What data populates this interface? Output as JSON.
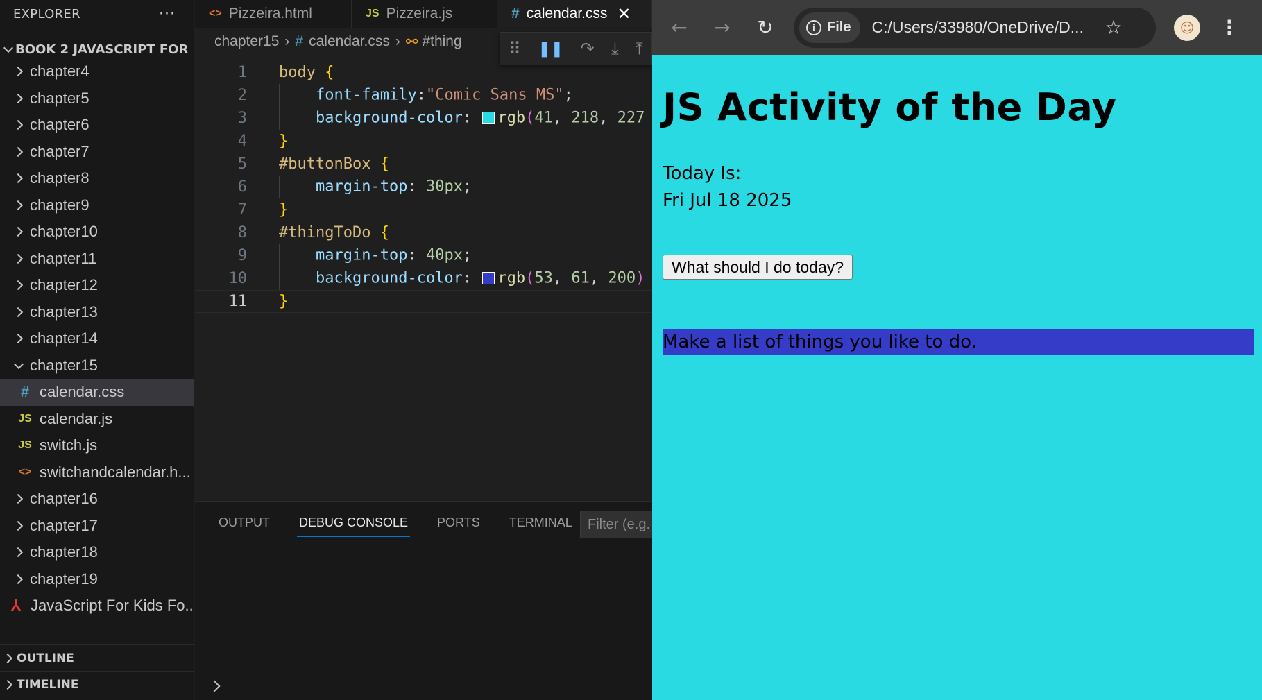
{
  "vscode": {
    "explorer": {
      "title": "EXPLORER",
      "more": "···",
      "project": "BOOK 2 JAVASCRIPT FOR ...",
      "folders_top": [
        "chapter4",
        "chapter5",
        "chapter6",
        "chapter7",
        "chapter8",
        "chapter9",
        "chapter10",
        "chapter11",
        "chapter12",
        "chapter13",
        "chapter14"
      ],
      "open_folder": "chapter15",
      "files": [
        {
          "icon": "#",
          "name": "calendar.css"
        },
        {
          "icon": "JS",
          "name": "calendar.js"
        },
        {
          "icon": "JS",
          "name": "switch.js"
        },
        {
          "icon": "<>",
          "name": "switchandcalendar.h..."
        }
      ],
      "folders_bottom": [
        "chapter16",
        "chapter17",
        "chapter18",
        "chapter19"
      ],
      "pdf_file": "JavaScript For Kids Fo...",
      "outline": "OUTLINE",
      "timeline": "TIMELINE"
    },
    "tabs": [
      {
        "icon": "<>",
        "label": "Pizzeira.html"
      },
      {
        "icon": "JS",
        "label": "Pizzeira.js"
      },
      {
        "icon": "#",
        "label": "calendar.css",
        "close": "✕"
      }
    ],
    "breadcrumbs": {
      "folder": "chapter15",
      "file_icon": "#",
      "file": "calendar.css",
      "symbol": "#thing"
    },
    "code_lines": [
      "1",
      "2",
      "3",
      "4",
      "5",
      "6",
      "7",
      "8",
      "9",
      "10",
      "11"
    ],
    "code": {
      "body_sel": "body",
      "ff_prop": "font-family",
      "ff_val": "\"Comic Sans MS\"",
      "bg_prop": "background-color",
      "bg1_fn": "rgb",
      "bg1_args": [
        "41",
        "218",
        "227"
      ],
      "bb_sel": "#buttonBox",
      "mt_prop": "margin-top",
      "mt1_val": "30px",
      "ttd_sel": "#thingToDo",
      "mt2_val": "40px",
      "bg2_fn": "rgb",
      "bg2_args": [
        "53",
        "61",
        "200"
      ]
    },
    "swatches": {
      "cyan": "#29dae3",
      "blue": "#353dc8"
    },
    "panel": {
      "tabs": [
        "OUTPUT",
        "DEBUG CONSOLE",
        "PORTS",
        "TERMINAL"
      ],
      "filter_placeholder": "Filter (e.g."
    }
  },
  "browser": {
    "file_chip": "File",
    "url": "C:/Users/33980/OneDrive/D...",
    "page": {
      "heading": "JS Activity of the Day",
      "today_label": "Today Is:",
      "today_date": "Fri Jul 18 2025",
      "button": "What should I do today?",
      "thing_to_do": "Make a list of things you like to do."
    },
    "colors": {
      "page_bg": "#29dae3",
      "thing_bg": "#353dc8"
    }
  }
}
